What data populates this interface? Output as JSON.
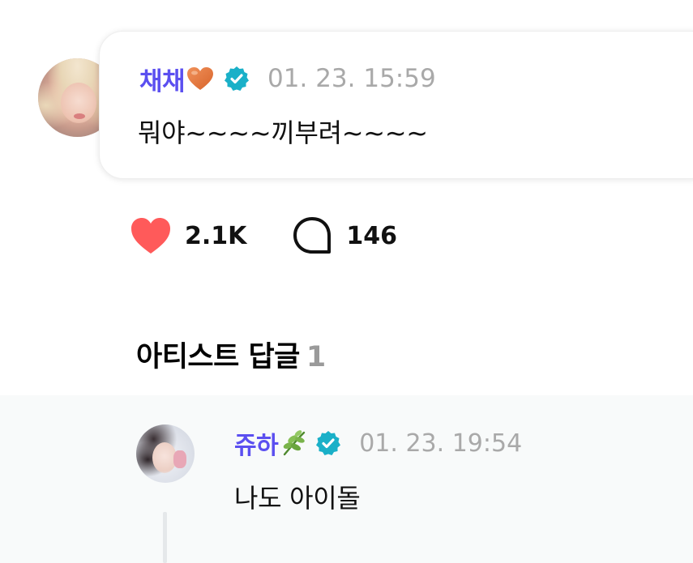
{
  "post": {
    "author": "채채",
    "author_emoji": "heart-emoji-orange",
    "timestamp": "01. 23. 15:59",
    "text": "뭐야~~~~끼부려~~~~"
  },
  "actions": {
    "likes": "2.1K",
    "comments": "146"
  },
  "artist_replies": {
    "title": "아티스트 답글",
    "count": "1"
  },
  "reply": {
    "author": "쥬하",
    "author_emoji": "herb-emoji",
    "timestamp": "01. 23. 19:54",
    "text": "나도 아이돌"
  },
  "colors": {
    "author_name": "#5b4ff0",
    "verified_badge": "#1ab0c8",
    "like_heart": "#ff5a5a",
    "timestamp": "#a9a9a9",
    "reply_background": "#f8fafa"
  }
}
